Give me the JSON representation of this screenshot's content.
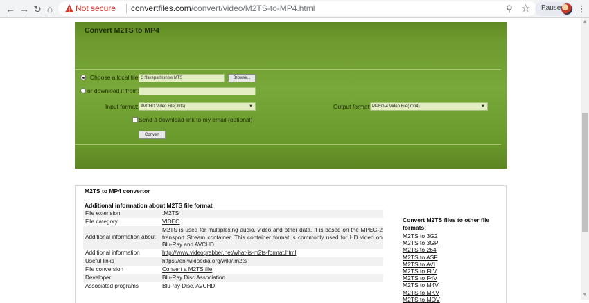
{
  "browser": {
    "not_secure": "Not secure",
    "url_host": "convertfiles.com",
    "url_path": "/convert/video/M2TS-to-MP4.html",
    "paused": "Paused",
    "icons": [
      "back-icon",
      "forward-icon",
      "reload-icon",
      "home-icon",
      "warning-icon",
      "zoom-icon",
      "star-icon",
      "menu-icon"
    ]
  },
  "converter": {
    "title": "Convert M2TS to MP4",
    "local_file_label": "Choose a local file:",
    "local_file_value": "C:\\fakepath\\snow.MTS",
    "browse_label": "Browse...",
    "download_label": "or download it from:",
    "download_value": "",
    "input_format_label": "Input format:",
    "input_format_value": "AVCHD Video File(.mts)",
    "output_format_label": "Output format:",
    "output_format_value": "MPEG-4 Video File(.mp4)",
    "email_label": "Send a download link to my email (optional)",
    "convert_label": "Convert"
  },
  "info": {
    "title": "M2TS to MP4 convertor",
    "subtitle": "Additional information about M2TS file format",
    "rows": [
      {
        "key": "File extension",
        "value": ".M2TS"
      },
      {
        "key": "File category",
        "value": "VIDEO"
      },
      {
        "key": "Additional information about",
        "value": "M2TS is used for multiplexing audio, video and other data. It is based on the MPEG-2 transport Stream container. This container format is commonly used for HD video on Blu-Ray and AVCHD."
      },
      {
        "key": "Additional information",
        "value": "http://www.videograbber.net/what-is-m2ts-format.html"
      },
      {
        "key": "Useful links",
        "value": "https://en.wikipedia.org/wiki/.m2ts"
      },
      {
        "key": "File conversion",
        "value": "Convert a M2TS file"
      },
      {
        "key": "Developer",
        "value": "Blu-Ray Disc Association"
      },
      {
        "key": "Associated programs",
        "value": "Blu-ray Disc, AVCHD"
      }
    ],
    "side_title": "Convert M2TS files to other file formats:",
    "side_links": [
      "M2TS to 3G2",
      "M2TS to 3GP",
      "M2TS to 264",
      "M2TS to ASF",
      "M2TS to AVI",
      "M2TS to FLV",
      "M2TS to F4V",
      "M2TS to M4V",
      "M2TS to MKV",
      "M2TS to MOV"
    ]
  }
}
